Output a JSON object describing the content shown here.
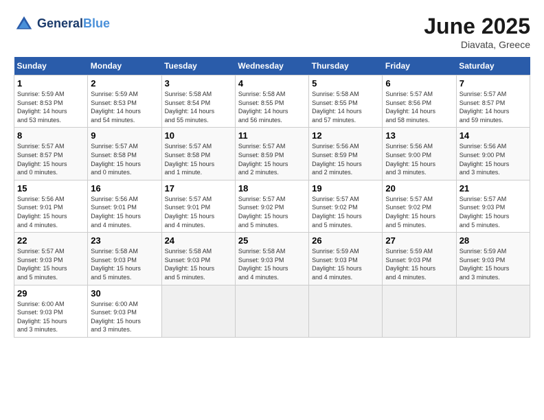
{
  "logo": {
    "line1": "General",
    "line2": "Blue"
  },
  "title": "June 2025",
  "location": "Diavata, Greece",
  "days_of_week": [
    "Sunday",
    "Monday",
    "Tuesday",
    "Wednesday",
    "Thursday",
    "Friday",
    "Saturday"
  ],
  "weeks": [
    [
      {
        "day": "1",
        "info": "Sunrise: 5:59 AM\nSunset: 8:53 PM\nDaylight: 14 hours\nand 53 minutes."
      },
      {
        "day": "2",
        "info": "Sunrise: 5:59 AM\nSunset: 8:53 PM\nDaylight: 14 hours\nand 54 minutes."
      },
      {
        "day": "3",
        "info": "Sunrise: 5:58 AM\nSunset: 8:54 PM\nDaylight: 14 hours\nand 55 minutes."
      },
      {
        "day": "4",
        "info": "Sunrise: 5:58 AM\nSunset: 8:55 PM\nDaylight: 14 hours\nand 56 minutes."
      },
      {
        "day": "5",
        "info": "Sunrise: 5:58 AM\nSunset: 8:55 PM\nDaylight: 14 hours\nand 57 minutes."
      },
      {
        "day": "6",
        "info": "Sunrise: 5:57 AM\nSunset: 8:56 PM\nDaylight: 14 hours\nand 58 minutes."
      },
      {
        "day": "7",
        "info": "Sunrise: 5:57 AM\nSunset: 8:57 PM\nDaylight: 14 hours\nand 59 minutes."
      }
    ],
    [
      {
        "day": "8",
        "info": "Sunrise: 5:57 AM\nSunset: 8:57 PM\nDaylight: 15 hours\nand 0 minutes."
      },
      {
        "day": "9",
        "info": "Sunrise: 5:57 AM\nSunset: 8:58 PM\nDaylight: 15 hours\nand 0 minutes."
      },
      {
        "day": "10",
        "info": "Sunrise: 5:57 AM\nSunset: 8:58 PM\nDaylight: 15 hours\nand 1 minute."
      },
      {
        "day": "11",
        "info": "Sunrise: 5:57 AM\nSunset: 8:59 PM\nDaylight: 15 hours\nand 2 minutes."
      },
      {
        "day": "12",
        "info": "Sunrise: 5:56 AM\nSunset: 8:59 PM\nDaylight: 15 hours\nand 2 minutes."
      },
      {
        "day": "13",
        "info": "Sunrise: 5:56 AM\nSunset: 9:00 PM\nDaylight: 15 hours\nand 3 minutes."
      },
      {
        "day": "14",
        "info": "Sunrise: 5:56 AM\nSunset: 9:00 PM\nDaylight: 15 hours\nand 3 minutes."
      }
    ],
    [
      {
        "day": "15",
        "info": "Sunrise: 5:56 AM\nSunset: 9:01 PM\nDaylight: 15 hours\nand 4 minutes."
      },
      {
        "day": "16",
        "info": "Sunrise: 5:56 AM\nSunset: 9:01 PM\nDaylight: 15 hours\nand 4 minutes."
      },
      {
        "day": "17",
        "info": "Sunrise: 5:57 AM\nSunset: 9:01 PM\nDaylight: 15 hours\nand 4 minutes."
      },
      {
        "day": "18",
        "info": "Sunrise: 5:57 AM\nSunset: 9:02 PM\nDaylight: 15 hours\nand 5 minutes."
      },
      {
        "day": "19",
        "info": "Sunrise: 5:57 AM\nSunset: 9:02 PM\nDaylight: 15 hours\nand 5 minutes."
      },
      {
        "day": "20",
        "info": "Sunrise: 5:57 AM\nSunset: 9:02 PM\nDaylight: 15 hours\nand 5 minutes."
      },
      {
        "day": "21",
        "info": "Sunrise: 5:57 AM\nSunset: 9:03 PM\nDaylight: 15 hours\nand 5 minutes."
      }
    ],
    [
      {
        "day": "22",
        "info": "Sunrise: 5:57 AM\nSunset: 9:03 PM\nDaylight: 15 hours\nand 5 minutes."
      },
      {
        "day": "23",
        "info": "Sunrise: 5:58 AM\nSunset: 9:03 PM\nDaylight: 15 hours\nand 5 minutes."
      },
      {
        "day": "24",
        "info": "Sunrise: 5:58 AM\nSunset: 9:03 PM\nDaylight: 15 hours\nand 5 minutes."
      },
      {
        "day": "25",
        "info": "Sunrise: 5:58 AM\nSunset: 9:03 PM\nDaylight: 15 hours\nand 4 minutes."
      },
      {
        "day": "26",
        "info": "Sunrise: 5:59 AM\nSunset: 9:03 PM\nDaylight: 15 hours\nand 4 minutes."
      },
      {
        "day": "27",
        "info": "Sunrise: 5:59 AM\nSunset: 9:03 PM\nDaylight: 15 hours\nand 4 minutes."
      },
      {
        "day": "28",
        "info": "Sunrise: 5:59 AM\nSunset: 9:03 PM\nDaylight: 15 hours\nand 3 minutes."
      }
    ],
    [
      {
        "day": "29",
        "info": "Sunrise: 6:00 AM\nSunset: 9:03 PM\nDaylight: 15 hours\nand 3 minutes."
      },
      {
        "day": "30",
        "info": "Sunrise: 6:00 AM\nSunset: 9:03 PM\nDaylight: 15 hours\nand 3 minutes."
      },
      {
        "day": "",
        "info": ""
      },
      {
        "day": "",
        "info": ""
      },
      {
        "day": "",
        "info": ""
      },
      {
        "day": "",
        "info": ""
      },
      {
        "day": "",
        "info": ""
      }
    ]
  ]
}
